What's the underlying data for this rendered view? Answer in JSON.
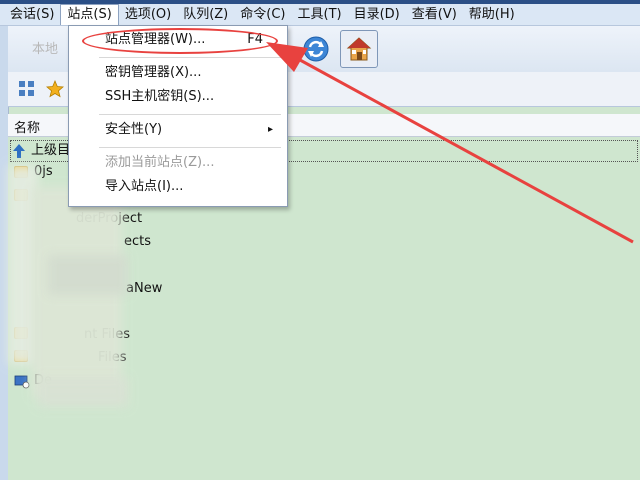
{
  "menubar": {
    "items": [
      {
        "label": "会话(S)"
      },
      {
        "label": "站点(S)"
      },
      {
        "label": "选项(O)"
      },
      {
        "label": "队列(Z)"
      },
      {
        "label": "命令(C)"
      },
      {
        "label": "工具(T)"
      },
      {
        "label": "目录(D)"
      },
      {
        "label": "查看(V)"
      },
      {
        "label": "帮助(H)"
      }
    ]
  },
  "toolbar": {
    "local_tab_label": "本地",
    "refresh_icon": "refresh-icon",
    "home_icon": "home-icon"
  },
  "file_list": {
    "column_name": "名称",
    "rows": [
      {
        "label": "上级目",
        "icon": "up-arrow-icon"
      },
      {
        "label": "0js",
        "icon": "folder-icon"
      },
      {
        "label": "derProject",
        "icon": "folder-icon"
      },
      {
        "label": "ects",
        "icon": "folder-icon"
      },
      {
        "label": "aNew",
        "icon": "folder-icon"
      },
      {
        "label": "nt Files",
        "icon": "folder-icon"
      },
      {
        "label": "Files",
        "icon": "folder-icon"
      },
      {
        "label": "De",
        "icon": "drive-icon"
      }
    ]
  },
  "site_menu": {
    "items": [
      {
        "label": "站点管理器(W)...",
        "accel": "F4"
      },
      {
        "label": "密钥管理器(X)..."
      },
      {
        "label": "SSH主机密钥(S)..."
      },
      {
        "label": "安全性(Y)",
        "submenu": "▸"
      },
      {
        "label": "添加当前站点(Z)...",
        "disabled": true
      },
      {
        "label": "导入站点(I)..."
      }
    ]
  },
  "annotation": {
    "color": "#e8423f"
  }
}
